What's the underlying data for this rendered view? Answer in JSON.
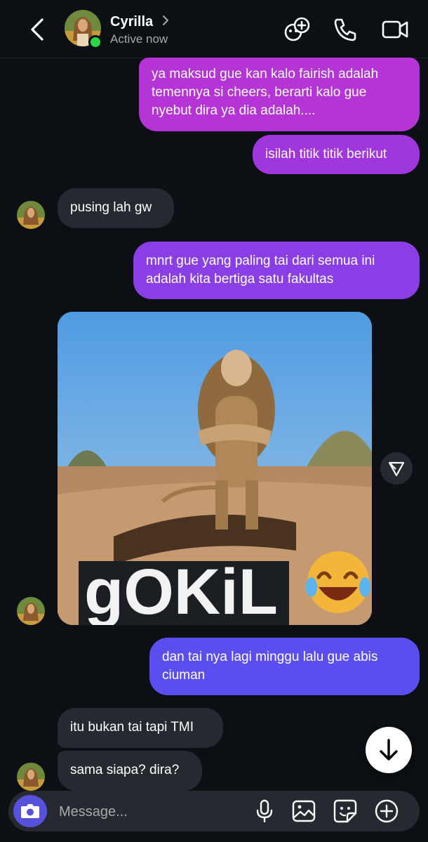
{
  "header": {
    "name": "Cyrilla",
    "status": "Active now",
    "icons": [
      "back-arrow-icon",
      "chevron-right-icon",
      "add-people-icon",
      "phone-icon",
      "video-camera-icon"
    ]
  },
  "messages": [
    {
      "from": "me",
      "text": "ya maksud gue kan kalo fairish adalah temennya si cheers, berarti kalo gue nyebut dira ya dia adalah...."
    },
    {
      "from": "me",
      "text": "isilah titik titik berikut"
    },
    {
      "from": "them",
      "text": "pusing lah gw"
    },
    {
      "from": "me",
      "text": "mnrt gue yang paling tai dari semua ini adalah kita bertiga satu fakultas"
    },
    {
      "from": "them",
      "type": "image",
      "caption": "gOKiL",
      "emoji": "😂"
    },
    {
      "from": "me",
      "text": "dan tai nya lagi minggu lalu gue abis ciuman"
    },
    {
      "from": "them",
      "text": "itu bukan tai tapi TMI"
    },
    {
      "from": "them",
      "text": "sama siapa? dira?"
    }
  ],
  "composer": {
    "placeholder": "Message...",
    "icons": [
      "camera-icon",
      "microphone-icon",
      "gallery-icon",
      "sticker-icon",
      "plus-icon"
    ]
  },
  "colors": {
    "background": "#0c1014",
    "incoming_bubble": "#262a30",
    "outgoing_top": "#b534d6",
    "outgoing_mid": "#8a3fe6",
    "outgoing_bottom": "#5b4ef0",
    "camera_button": "#5851db"
  }
}
